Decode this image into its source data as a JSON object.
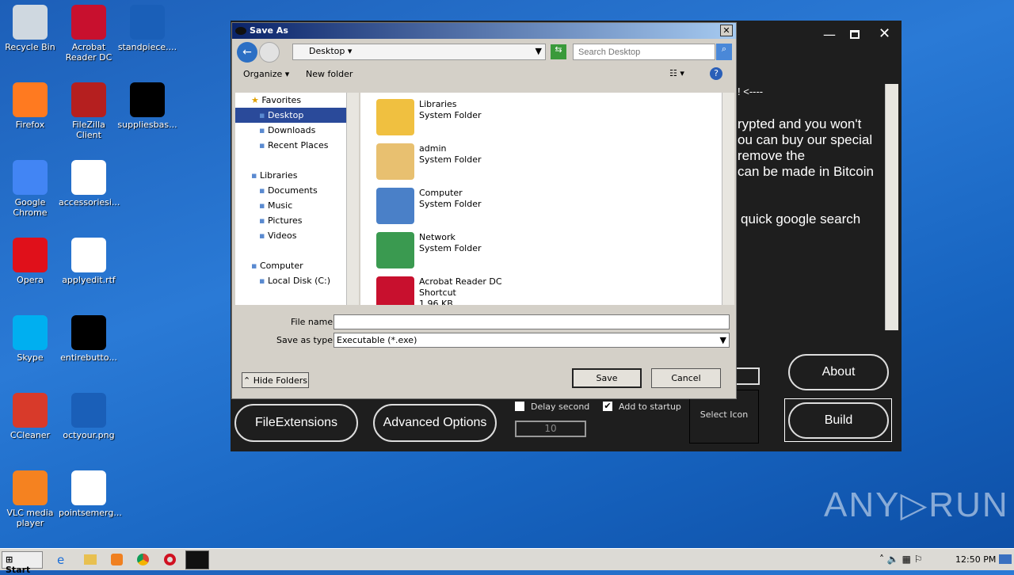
{
  "desktop": {
    "col1": [
      "Recycle Bin",
      "Firefox",
      "Google Chrome",
      "Opera",
      "Skype",
      "CCleaner",
      "VLC media player"
    ],
    "col2": [
      "Acrobat Reader DC",
      "FileZilla Client",
      "accessoriesi...",
      "applyedit.rtf",
      "entirebutto...",
      "octyour.png",
      "pointsemerg..."
    ],
    "col3": [
      "standpiece....",
      "suppliesbas..."
    ]
  },
  "app": {
    "lines": [
      "! <----",
      "rypted and you won't",
      "ou can buy our special",
      "remove the",
      "can be made in Bitcoin",
      "quick google search"
    ],
    "file_extensions": "FileExtensions",
    "advanced_options": "Advanced Options",
    "delay_second": "Delay second",
    "delay_checked": false,
    "add_to_startup": "Add to startup",
    "startup_checked": true,
    "delay_value": "10",
    "select_icon": "Select Icon",
    "about": "About",
    "build": "Build"
  },
  "dialog": {
    "title": "Save As",
    "location": "Desktop",
    "search_placeholder": "Search Desktop",
    "organize": "Organize",
    "new_folder": "New folder",
    "tree": [
      "Favorites",
      "Desktop",
      "Downloads",
      "Recent Places",
      "Libraries",
      "Documents",
      "Music",
      "Pictures",
      "Videos",
      "Computer",
      "Local Disk (C:)"
    ],
    "files": [
      {
        "name": "Libraries",
        "type": "System Folder"
      },
      {
        "name": "admin",
        "type": "System Folder"
      },
      {
        "name": "Computer",
        "type": "System Folder"
      },
      {
        "name": "Network",
        "type": "System Folder"
      },
      {
        "name": "Acrobat Reader DC",
        "type": "Shortcut",
        "size": "1.96 KB"
      }
    ],
    "file_name_label": "File name:",
    "file_name": "",
    "save_type_label": "Save as type:",
    "save_type": "Executable (*.exe)",
    "hide_folders": "Hide Folders",
    "save": "Save",
    "cancel": "Cancel"
  },
  "taskbar": {
    "start": "Start",
    "clock": "12:50 PM"
  },
  "watermark": "ANY RUN"
}
